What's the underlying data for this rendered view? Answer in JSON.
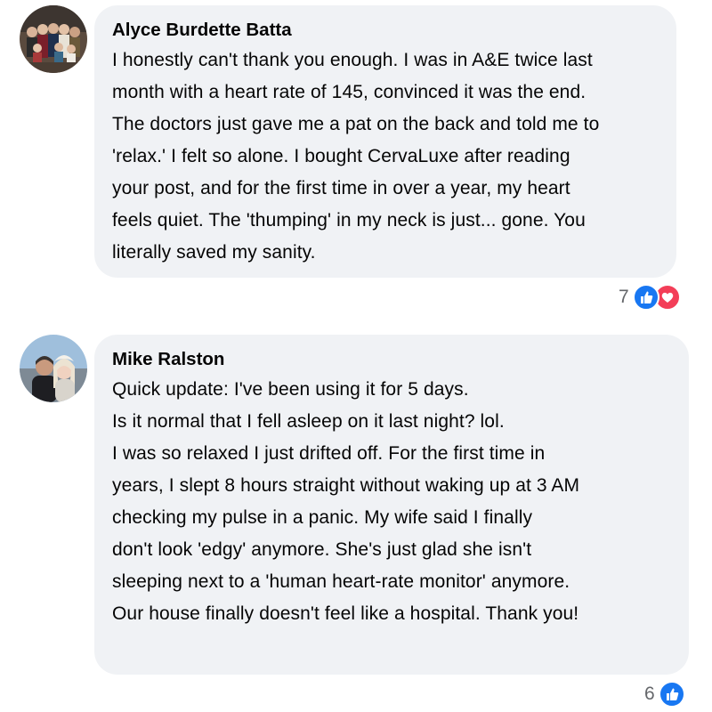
{
  "comments": [
    {
      "author": "Alyce Burdette Batta",
      "lines": [
        "I honestly can't thank you enough. I was in A&E twice last",
        "month with a heart rate of 145, convinced it was the end.",
        "The doctors just gave me a pat on the back and told me to",
        "'relax.' I felt so alone. I bought CervaLuxe after reading",
        "your post, and for the first time in over a year, my heart",
        "feels quiet. The 'thumping' in my neck is just... gone. You",
        "literally saved my sanity."
      ],
      "reaction_count": "7",
      "reactions": [
        "like-icon",
        "love-icon"
      ]
    },
    {
      "author": "Mike Ralston",
      "lines": [
        "Quick update: I've been using it for 5 days.",
        "Is it normal that I fell asleep on it last night? lol.",
        "I was so relaxed I just drifted off. For the first time in",
        "years, I slept 8 hours straight without waking up at 3 AM",
        "checking my pulse in a panic. My wife said I finally",
        "don't look 'edgy' anymore. She's just glad she isn't",
        "sleeping next to a 'human heart-rate monitor' anymore.",
        "Our house finally doesn't feel like a hospital. Thank you!"
      ],
      "reaction_count": "6",
      "reactions": [
        "like-icon"
      ]
    }
  ],
  "colors": {
    "bubble": "#f0f2f5",
    "like": "#1877f2",
    "love": "#f33e58",
    "muted": "#65676b"
  }
}
